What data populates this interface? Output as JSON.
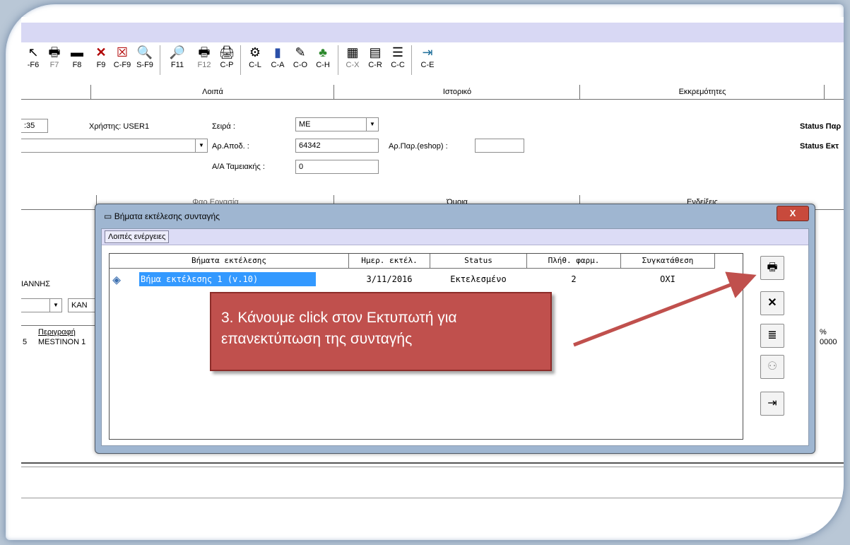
{
  "toolbar": {
    "buttons": [
      {
        "key": "-F6",
        "icon": "↖"
      },
      {
        "key": "F7",
        "icon": "🖶"
      },
      {
        "key": "F8",
        "icon": "▬"
      },
      {
        "key": "F9",
        "icon": "✕"
      },
      {
        "key": "C-F9",
        "icon": "☒"
      },
      {
        "key": "S-F9",
        "icon": "🔍"
      },
      {
        "key": "F11",
        "icon": "🔎"
      },
      {
        "key": "F12",
        "icon": "🖶"
      },
      {
        "key": "C-P",
        "icon": "🖨"
      },
      {
        "key": "C-L",
        "icon": "⚙"
      },
      {
        "key": "C-A",
        "icon": "▮"
      },
      {
        "key": "C-O",
        "icon": "✎"
      },
      {
        "key": "C-H",
        "icon": "♣"
      },
      {
        "key": "C-X",
        "icon": "▦"
      },
      {
        "key": "C-R",
        "icon": "▤"
      },
      {
        "key": "C-C",
        "icon": "☰"
      },
      {
        "key": "C-E",
        "icon": "⇥"
      }
    ]
  },
  "tabs_top": [
    "Λοιπά",
    "Ιστορικό",
    "Εκκρεμότητες"
  ],
  "form": {
    "time_fragment": ":35",
    "user_label": "Χρήστης: USER1",
    "series_label": "Σειρά :",
    "series_value": "ΜΕ",
    "ar_apod_label": "Αρ.Αποδ. :",
    "ar_apod_value": "64342",
    "ar_par_label": "Αρ.Παρ.(eshop) :",
    "ar_par_value": "",
    "aa_label": "Α/Α Ταμειακής :",
    "aa_value": "0",
    "status_par": "Status Παρ",
    "status_ekt": "Status Εκτ"
  },
  "tabs_mid": [
    "Φαρ.Εργασία",
    "Όμοια",
    "Ενδείξεις"
  ],
  "left_fragments": {
    "name": "ΙΑΝΝΗΣ",
    "combo": "ΚΑΝ",
    "col_a": "Περιγραφή",
    "col_num": "5",
    "row_item": "MESTINON 1",
    "pct": "%",
    "pct_val": "0000"
  },
  "dialog": {
    "title": "Βήματα εκτέλεσης συνταγής",
    "close_label": "X",
    "menu_label": "Λοιπές ενέργειες",
    "columns": [
      "Βήματα εκτέλεσης",
      "Ημερ. εκτέλ.",
      "Status",
      "Πλήθ. φαρμ.",
      "Συγκατάθεση"
    ],
    "row": {
      "step": "Βήμα εκτέλεσης 1 (v.10)",
      "date": "3/11/2016",
      "status": "Εκτελεσμένο",
      "count": "2",
      "consent": "ΟΧΙ"
    }
  },
  "callout": {
    "line1": "3. Κάνουμε click στον Εκτυπωτή για",
    "line2": "επανεκτύπωση της συνταγής"
  },
  "colors": {
    "callout_fill": "#c0504d",
    "arrow": "#c0504d",
    "selection": "#3399ff"
  }
}
